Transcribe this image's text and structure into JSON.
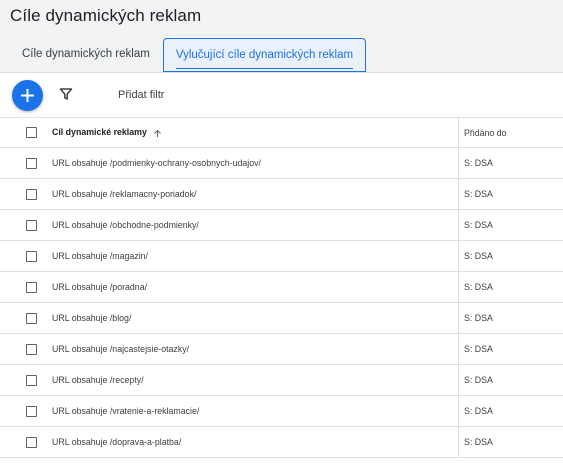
{
  "page": {
    "title": "Cíle dynamických reklam"
  },
  "tabs": [
    {
      "label": "Cíle dynamických reklam",
      "active": false
    },
    {
      "label": "Vylučující cíle dynamických reklam",
      "active": true
    }
  ],
  "toolbar": {
    "add_filter_label": "Přidat filtr",
    "add_icon": "plus-icon",
    "filter_icon": "filter-icon"
  },
  "table": {
    "columns": {
      "name": "Cíl dynamické reklamy",
      "added": "Přidáno do"
    },
    "sort_icon": "arrow-up-icon",
    "rows": [
      {
        "name": "URL obsahuje /podmienky-ochrany-osobnych-udajov/",
        "added": "S: DSA"
      },
      {
        "name": "URL obsahuje /reklamacny-poriadok/",
        "added": "S: DSA"
      },
      {
        "name": "URL obsahuje /obchodne-podmienky/",
        "added": "S: DSA"
      },
      {
        "name": "URL obsahuje /magazin/",
        "added": "S: DSA"
      },
      {
        "name": "URL obsahuje /poradna/",
        "added": "S: DSA"
      },
      {
        "name": "URL obsahuje /blog/",
        "added": "S: DSA"
      },
      {
        "name": "URL obsahuje /najcastejsie-otazky/",
        "added": "S: DSA"
      },
      {
        "name": "URL obsahuje /recepty/",
        "added": "S: DSA"
      },
      {
        "name": "URL obsahuje /vratenie-a-reklamacie/",
        "added": "S: DSA"
      },
      {
        "name": "URL obsahuje /doprava-a-platba/",
        "added": "S: DSA"
      }
    ]
  },
  "colors": {
    "accent": "#1a73e8",
    "background": "#f1f3f4",
    "panel": "#ffffff"
  }
}
